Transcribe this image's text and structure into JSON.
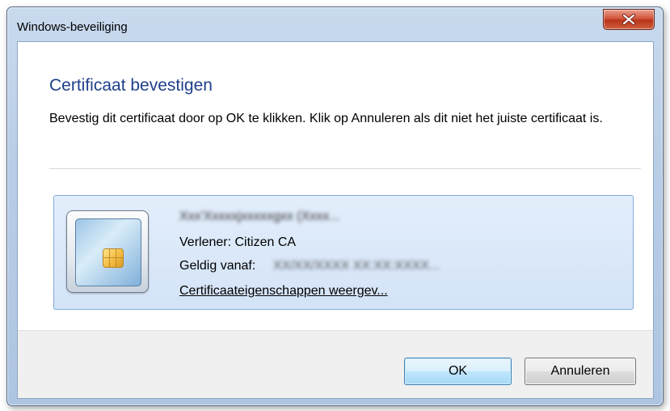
{
  "window": {
    "title": "Windows-beveiliging",
    "close_icon": "close-icon"
  },
  "dialog": {
    "heading": "Certificaat bevestigen",
    "description": "Bevestig dit certificaat door op OK te klikken. Klik op Annuleren als dit niet het juiste certificaat is."
  },
  "certificate": {
    "icon": "smartcard-icon",
    "name": "Xxx'Xxxxxjxxxxxgxx (Xxxx...",
    "issuer_text": "Verlener: Citizen CA",
    "valid_label": "Geldig vanaf:",
    "valid_value": "XX/XX/XXXX XX:XX:XXXX...",
    "properties_link": "Certificaateigenschappen weergev..."
  },
  "buttons": {
    "ok_label": "OK",
    "cancel_label": "Annuleren"
  },
  "colors": {
    "heading": "#1e3f8a",
    "close_button": "#c84a31",
    "cert_panel": "#dbe8f9"
  }
}
